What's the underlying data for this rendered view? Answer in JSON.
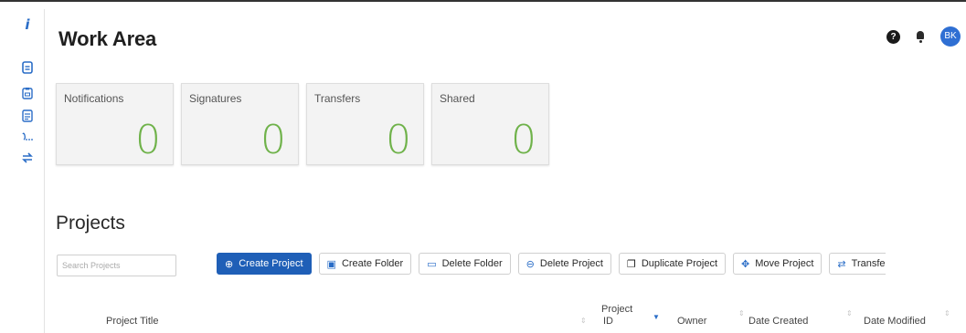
{
  "header": {
    "title": "Work Area",
    "avatar_initials": "BK"
  },
  "sidebar": {
    "items": [
      {
        "icon": "info-icon",
        "label": "i"
      },
      {
        "icon": "document-icon"
      },
      {
        "icon": "clipboard-icon"
      },
      {
        "icon": "form-icon"
      },
      {
        "icon": "signature-icon"
      },
      {
        "icon": "transfer-icon"
      }
    ]
  },
  "cards": [
    {
      "label": "Notifications",
      "count": "0"
    },
    {
      "label": "Signatures",
      "count": "0"
    },
    {
      "label": "Transfers",
      "count": "0"
    },
    {
      "label": "Shared",
      "count": "0"
    }
  ],
  "projects": {
    "heading": "Projects",
    "search_placeholder": "Search Projects",
    "toolbar": {
      "create_project": "Create Project",
      "create_folder": "Create Folder",
      "delete_folder": "Delete Folder",
      "delete_project": "Delete Project",
      "duplicate_project": "Duplicate Project",
      "move_project": "Move Project",
      "transfer": "Transfe"
    },
    "columns": {
      "title": "Project Title",
      "project_id_line1": "Project",
      "project_id_line2": "ID",
      "owner": "Owner",
      "date_created": "Date Created",
      "date_modified": "Date Modified"
    }
  },
  "colors": {
    "accent": "#1f5fb7",
    "count_green": "#6fb24a"
  }
}
